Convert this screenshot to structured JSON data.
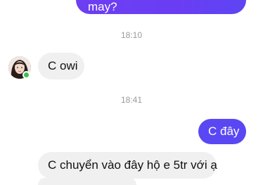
{
  "messages": {
    "top_sent_partial": "may?",
    "timestamp_1": "18:10",
    "received_1": "C owi",
    "timestamp_2": "18:41",
    "sent_1": "C đây",
    "received_2": "C chuyển vào đây hộ e 5tr với ạ"
  },
  "colors": {
    "sent_bubble": "#6c3cf4",
    "received_bubble": "#f0f0f0",
    "online_indicator": "#37c24e",
    "timestamp_text": "#9a9a9a"
  },
  "icons": {
    "avatar": "contact-avatar",
    "presence": "online-dot"
  }
}
